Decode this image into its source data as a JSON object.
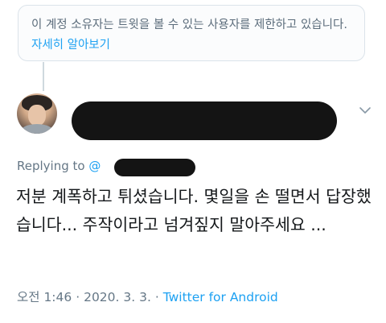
{
  "notice": {
    "text": "이 계정 소유자는 트윗을 볼 수 있는 사용자를 제한하고 있습니다.",
    "link": "자세히 알아보기"
  },
  "tweet": {
    "replying_to_label": "Replying to",
    "replying_to_handle": "@",
    "body": "저분 계폭하고 튀셨습니다. 몇일을 손 떨면서 답장했습니다... 주작이라고 넘겨짚지 말아주세요 ...",
    "time": "오전 1:46",
    "separator": "·",
    "date": "2020. 3. 3.",
    "source": "Twitter for Android"
  },
  "colors": {
    "link": "#1da1f2",
    "secondary_text": "#657786",
    "primary_text": "#14171a",
    "redaction": "#141414"
  },
  "icons": {
    "avatar": "user-avatar",
    "more": "chevron-down-icon"
  }
}
